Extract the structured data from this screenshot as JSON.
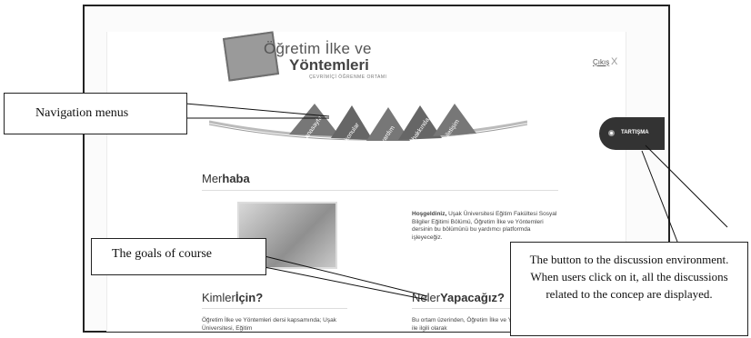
{
  "logo": {
    "line1": "Öğretim İlke ve",
    "line2": "Yöntemleri",
    "tagline": "ÇEVRİMİÇİ ÖĞRENME ORTAMI"
  },
  "header": {
    "logout_label": "Çıkış",
    "logout_icon": "X"
  },
  "nav": {
    "tabs": [
      "anasayfa",
      "konular",
      "yardım",
      "hakkında",
      "iletişim"
    ]
  },
  "discussion_button": {
    "label": "TARTIŞMA"
  },
  "welcome": {
    "heading_light": "Mer",
    "heading_bold": "haba",
    "bold_lead": "Hoşgeldiniz,",
    "text": " Uşak Üniversitesi Eğitim Fakültesi Sosyal Bilgiler Eğitimi Bölümü, Öğretim İlke ve Yöntemleri dersinin bu bölümünü bu yardımcı platformda işleyeceğiz."
  },
  "sections": {
    "left": {
      "heading_light": "Kimler",
      "heading_bold": "İçin?",
      "text": "Öğretim İlke ve Yöntemleri dersi kapsamında; Uşak Üniversitesi, Eğitim"
    },
    "right": {
      "heading_light": "Neler",
      "heading_bold": "Yapacağız?",
      "text": "Bu ortam üzerinden, Öğretim İlke ve Yöntemleri dersi ile ilgili olarak"
    }
  },
  "annotations": {
    "navigation": "Navigation menus",
    "goals": "The goals of course",
    "discussion": "The button to the discussion environment.  When users click on it, all the discussions related to the concep are displayed."
  }
}
